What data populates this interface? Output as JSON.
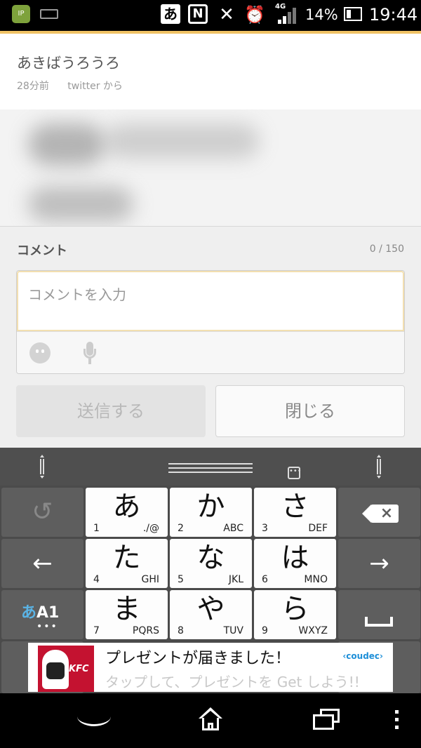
{
  "status_bar": {
    "app_icon_text": "IP",
    "ime_indicator": "あ",
    "nfc": "N",
    "network": "4G",
    "battery_pct": "14%",
    "time": "19:44"
  },
  "post": {
    "author": "あきばうろうろ",
    "time": "28分前",
    "source": "twitter から"
  },
  "comment": {
    "label": "コメント",
    "counter": "0 / 150",
    "placeholder": "コメントを入力",
    "value": ""
  },
  "buttons": {
    "send": "送信する",
    "close": "閉じる"
  },
  "keyboard": {
    "keys": [
      {
        "kana": "あ",
        "num": "1",
        "alpha": "./@"
      },
      {
        "kana": "か",
        "num": "2",
        "alpha": "ABC"
      },
      {
        "kana": "さ",
        "num": "3",
        "alpha": "DEF"
      },
      {
        "kana": "た",
        "num": "4",
        "alpha": "GHI"
      },
      {
        "kana": "な",
        "num": "5",
        "alpha": "JKL"
      },
      {
        "kana": "は",
        "num": "6",
        "alpha": "MNO"
      },
      {
        "kana": "ま",
        "num": "7",
        "alpha": "PQRS"
      },
      {
        "kana": "や",
        "num": "8",
        "alpha": "TUV"
      },
      {
        "kana": "ら",
        "num": "9",
        "alpha": "WXYZ"
      }
    ],
    "mode_kana": "あ",
    "mode_alpha": "A1",
    "mode_dots": "•••",
    "menu_icon": "•••",
    "undo_glyph": "↺",
    "left_glyph": "←",
    "right_glyph": "→",
    "backspace_glyph": "×"
  },
  "ad": {
    "logo_text": "KFC",
    "headline": "プレゼントが届きました！",
    "brand": "‹coudec›",
    "cta": "タップして、プレゼントを Get しよう!!"
  },
  "icons": {
    "status": [
      "app-ip-icon",
      "keyboard-icon",
      "ime-icon",
      "nfc-icon",
      "mute-icon",
      "alarm-icon",
      "signal-icon",
      "battery-icon"
    ],
    "nav": [
      "back-icon",
      "home-icon",
      "recent-apps-icon",
      "menu-icon"
    ]
  },
  "colors": {
    "accent": "#f0c264",
    "mode_highlight": "#5ab4e6",
    "kfc_red": "#c41230",
    "ad_brand": "#1e8fd8"
  }
}
